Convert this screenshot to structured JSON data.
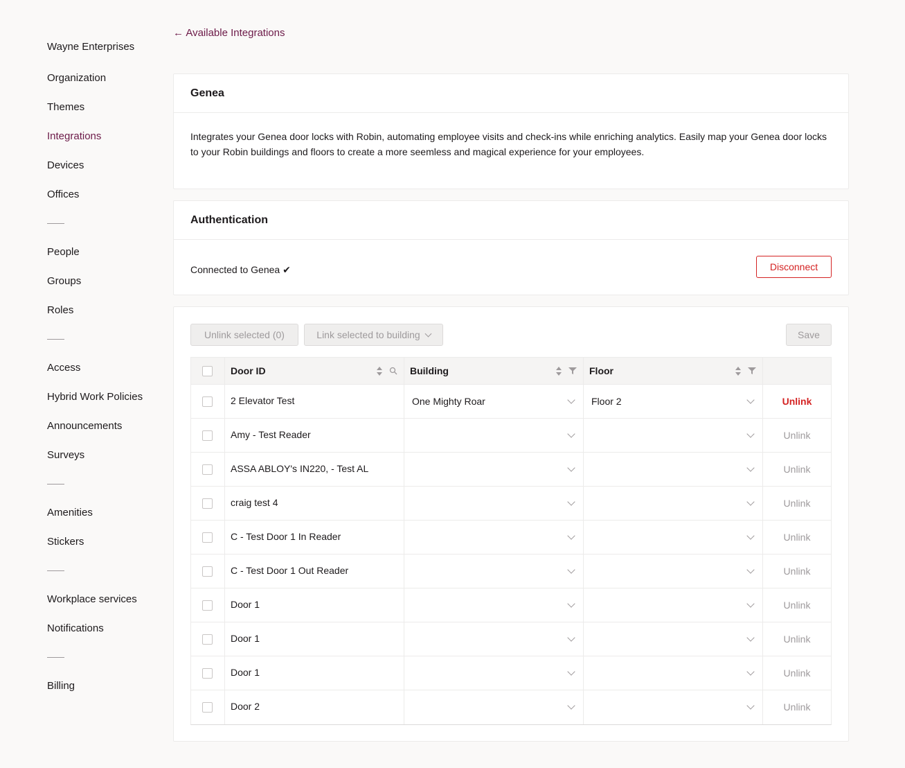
{
  "sidebar": {
    "org_name": "Wayne Enterprises",
    "groups": [
      [
        "Organization",
        "Themes",
        "Integrations",
        "Devices",
        "Offices"
      ],
      [
        "People",
        "Groups",
        "Roles"
      ],
      [
        "Access",
        "Hybrid Work Policies",
        "Announcements",
        "Surveys"
      ],
      [
        "Amenities",
        "Stickers"
      ],
      [
        "Workplace services",
        "Notifications"
      ],
      [
        "Billing"
      ]
    ],
    "active": "Integrations"
  },
  "back_link": "← Available Integrations",
  "integration": {
    "title": "Genea",
    "description": "Integrates your Genea door locks with Robin, automating employee visits and check-ins while enriching analytics. Easily map your Genea door locks to your Robin buildings and floors to create a more seemless and magical experience for your employees."
  },
  "auth": {
    "title": "Authentication",
    "status": "Connected to Genea ✔",
    "disconnect_label": "Disconnect"
  },
  "mapping": {
    "unlink_selected_label": "Unlink selected (0)",
    "link_selected_label": "Link selected to building",
    "save_label": "Save",
    "columns": {
      "door": "Door ID",
      "building": "Building",
      "floor": "Floor"
    },
    "rows": [
      {
        "door": "2 Elevator Test",
        "building": "One Mighty Roar",
        "floor": "Floor 2",
        "action": "Unlink",
        "linked": true
      },
      {
        "door": "Amy - Test Reader",
        "building": "",
        "floor": "",
        "action": "Unlink",
        "linked": false
      },
      {
        "door": "ASSA ABLOY's IN220, - Test AL",
        "building": "",
        "floor": "",
        "action": "Unlink",
        "linked": false
      },
      {
        "door": "craig test 4",
        "building": "",
        "floor": "",
        "action": "Unlink",
        "linked": false
      },
      {
        "door": "C - Test Door 1 In Reader",
        "building": "",
        "floor": "",
        "action": "Unlink",
        "linked": false
      },
      {
        "door": "C - Test Door 1 Out Reader",
        "building": "",
        "floor": "",
        "action": "Unlink",
        "linked": false
      },
      {
        "door": "Door 1",
        "building": "",
        "floor": "",
        "action": "Unlink",
        "linked": false
      },
      {
        "door": "Door 1",
        "building": "",
        "floor": "",
        "action": "Unlink",
        "linked": false
      },
      {
        "door": "Door 1",
        "building": "",
        "floor": "",
        "action": "Unlink",
        "linked": false
      },
      {
        "door": "Door 2",
        "building": "",
        "floor": "",
        "action": "Unlink",
        "linked": false
      }
    ]
  },
  "colors": {
    "accent": "#6c1a48",
    "danger": "#d42222",
    "muted": "#9e9a9c",
    "background": "#faf9f8"
  }
}
